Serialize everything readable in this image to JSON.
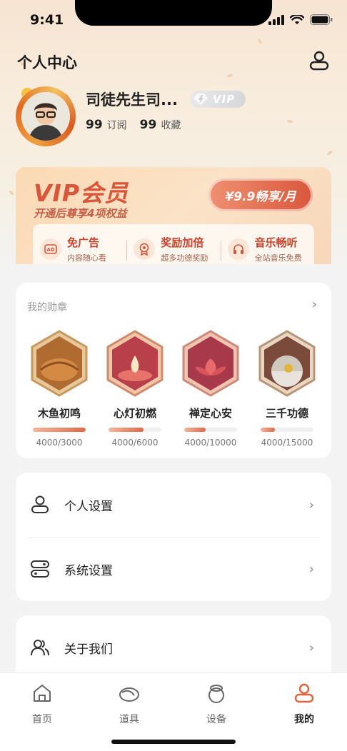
{
  "status": {
    "time": "9:41"
  },
  "header": {
    "title": "个人中心"
  },
  "profile": {
    "name": "司徒先生司...",
    "vip_badge": "VIP",
    "stats": [
      {
        "value": "99",
        "label": "订阅"
      },
      {
        "value": "99",
        "label": "收藏"
      }
    ]
  },
  "vip": {
    "title": "VIP会员",
    "subtitle": "开通后尊享4项权益",
    "price_button": "¥9.9畅享/月",
    "perks": [
      {
        "title": "免广告",
        "desc": "内容随心看",
        "icon": "ad-icon"
      },
      {
        "title": "奖励加倍",
        "desc": "超多功德奖励",
        "icon": "award-icon"
      },
      {
        "title": "音乐畅听",
        "desc": "全站音乐免费",
        "icon": "headphones-icon"
      }
    ]
  },
  "medals": {
    "header": "我的勋章",
    "items": [
      {
        "name": "木鱼初鸣",
        "progress": "4000/3000",
        "fill": 1.0,
        "color": "#c9884a"
      },
      {
        "name": "心灯初燃",
        "progress": "4000/6000",
        "fill": 0.667,
        "color": "#c9504a"
      },
      {
        "name": "禅定心安",
        "progress": "4000/10000",
        "fill": 0.4,
        "color": "#c94a5a"
      },
      {
        "name": "三千功德",
        "progress": "4000/15000",
        "fill": 0.267,
        "color": "#b2a08a"
      }
    ]
  },
  "settings": {
    "items": [
      {
        "label": "个人设置",
        "icon": "person-icon"
      },
      {
        "label": "系统设置",
        "icon": "toggle-icon"
      }
    ]
  },
  "about": {
    "label": "关于我们",
    "icon": "group-icon"
  },
  "tabs": [
    {
      "label": "首页",
      "icon": "home-icon",
      "active": false
    },
    {
      "label": "道具",
      "icon": "woodfish-icon",
      "active": false
    },
    {
      "label": "设备",
      "icon": "ring-icon",
      "active": false
    },
    {
      "label": "我的",
      "icon": "profile-icon",
      "active": true
    }
  ],
  "colors": {
    "accent": "#e0623f",
    "vip_text": "#d9563a"
  }
}
